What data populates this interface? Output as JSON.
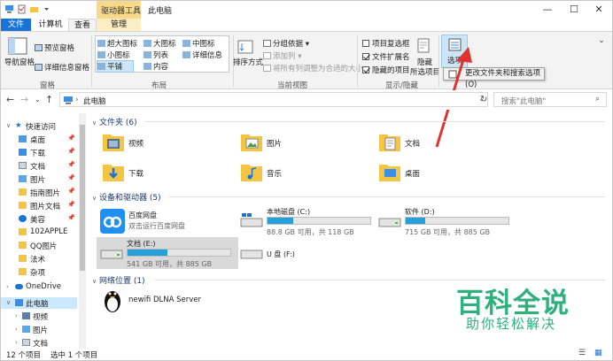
{
  "window": {
    "context_tab": "驱动器工具",
    "title": "此电脑",
    "minimize": "—",
    "maximize": "☐",
    "close": "✕"
  },
  "tabs": [
    "文件",
    "计算机",
    "查看",
    "管理"
  ],
  "ribbon": {
    "pane": {
      "nav_pane": "导航窗格",
      "preview": "预览窗格",
      "details": "详细信息窗格",
      "group": "窗格"
    },
    "layout": {
      "items": [
        "超大图标",
        "大图标",
        "中图标",
        "小图标",
        "列表",
        "详细信息",
        "平铺",
        "内容"
      ],
      "group": "布局"
    },
    "current_view": {
      "sort": "排序方式",
      "group_by": "分组依据",
      "add_column": "添加列",
      "fit_columns": "将所有列调整为合适的大小",
      "group": "当前视图"
    },
    "show_hide": {
      "item_checkbox": "项目复选框",
      "extensions": "文件扩展名",
      "hidden": "隐藏的项目",
      "hide_selected": "隐藏",
      "hide_selected2": "所选项目",
      "group": "显示/隐藏"
    },
    "options": {
      "label": "选项",
      "tooltip": "更改文件夹和搜索选项(O)"
    }
  },
  "address": {
    "path": "此电脑",
    "search_placeholder": "搜索\"此电脑\""
  },
  "nav": {
    "quick_access": "快速访问",
    "pinned": [
      "桌面",
      "下载",
      "文档",
      "图片",
      "指南图片",
      "图片文档",
      "美容"
    ],
    "recent": [
      "102APPLE",
      "QQ图片",
      "法术",
      "杂项"
    ],
    "onedrive": "OneDrive",
    "this_pc": "此电脑",
    "pc_children": [
      "视频",
      "图片",
      "文档"
    ]
  },
  "content": {
    "folders_header": "文件夹 (6)",
    "folders": [
      "视频",
      "图片",
      "文档",
      "下载",
      "音乐",
      "桌面"
    ],
    "devices_header": "设备和驱动器 (5)",
    "devices": [
      {
        "name": "百度网盘",
        "sub": "双击运行百度网盘",
        "fill": null
      },
      {
        "name": "本地磁盘 (C:)",
        "sub": "88.8 GB 可用，共 118 GB",
        "fill": 0.25
      },
      {
        "name": "软件 (D:)",
        "sub": "715 GB 可用，共 885 GB",
        "fill": 0.19
      },
      {
        "name": "文档 (E:)",
        "sub": "541 GB 可用，共 885 GB",
        "fill": 0.39
      },
      {
        "name": "U 盘 (F:)",
        "sub": "",
        "fill": null
      }
    ],
    "network_header": "网络位置 (1)",
    "network": [
      "newifi DLNA Server"
    ]
  },
  "status": {
    "count": "12 个项目",
    "selected": "选中 1 个项目"
  },
  "watermark": {
    "line1": "百科全说",
    "line2": "助你轻松解决"
  },
  "colors": {
    "accent": "#1a73d6",
    "selection": "#cce8ff",
    "bar": "#26a0da",
    "arrow": "#e0332f",
    "watermark": "#2fb07c"
  }
}
